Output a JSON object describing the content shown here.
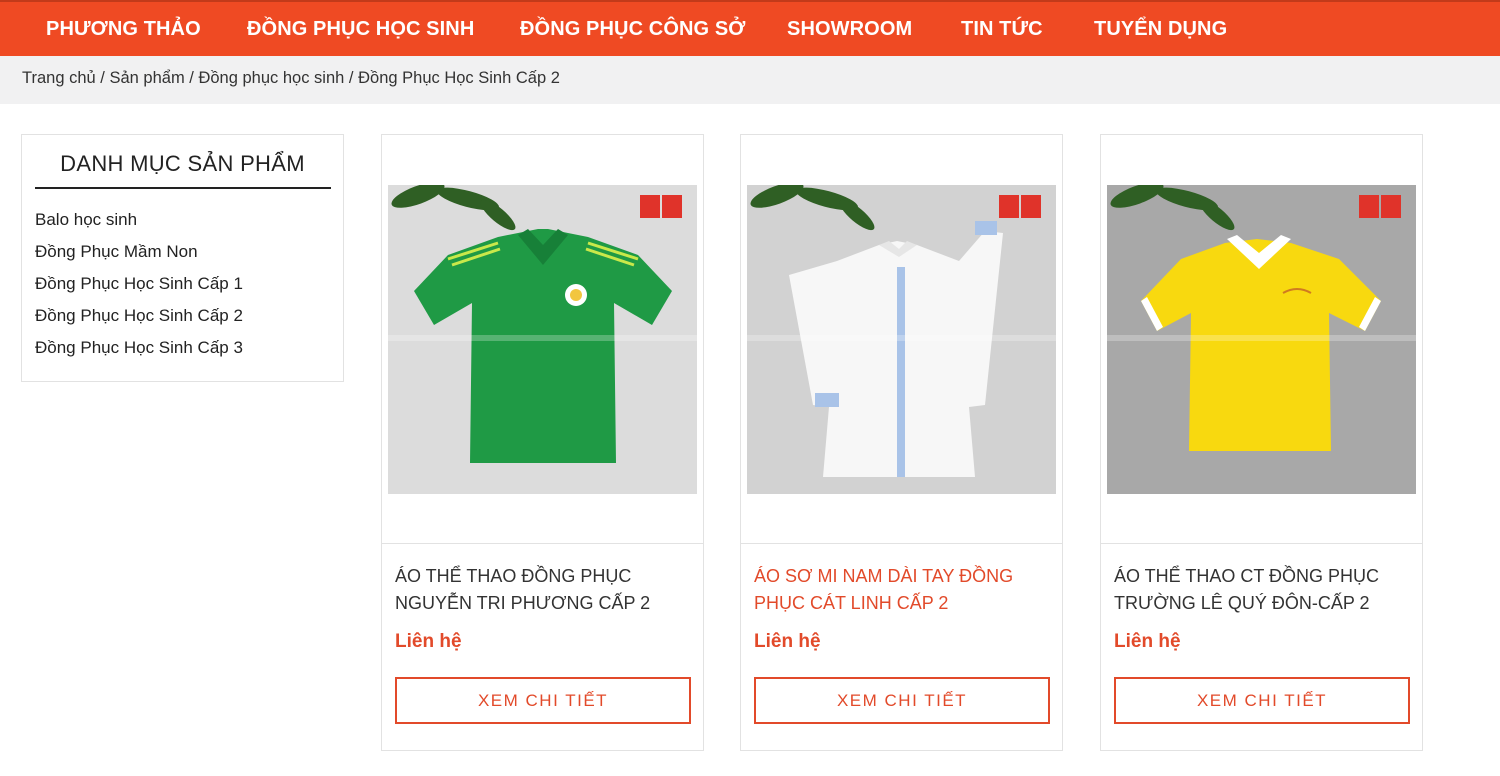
{
  "nav": {
    "items": [
      "PHƯƠNG THẢO",
      "ĐỒNG PHỤC HỌC SINH",
      "ĐỒNG PHỤC CÔNG SỞ",
      "SHOWROOM",
      "TIN TỨC",
      "TUYỂN DỤNG"
    ]
  },
  "breadcrumb": {
    "items": [
      "Trang chủ",
      "Sản phẩm",
      "Đồng phục học sinh",
      "Đồng Phục Học Sinh Cấp 2"
    ],
    "separator": "/"
  },
  "sidebar": {
    "title": "DANH MỤC SẢN PHẨM",
    "categories": [
      "Balo học sinh",
      "Đồng Phục Mầm Non",
      "Đồng Phục Học Sinh Cấp 1",
      "Đồng Phục Học Sinh Cấp 2",
      "Đồng Phục Học Sinh Cấp 3"
    ]
  },
  "products": [
    {
      "title_line1": "ÁO THỂ THAO ĐỒNG PHỤC",
      "title_line2": "NGUYỄN TRI PHƯƠNG CẤP 2",
      "price": "Liên hệ",
      "button": "XEM CHI TIẾT",
      "shirt_color": "#1f9a45"
    },
    {
      "title_line1": "ÁO SƠ MI NAM DÀI TAY ĐỒNG",
      "title_line2": "PHỤC CÁT LINH CẤP 2",
      "price": "Liên hệ",
      "button": "XEM CHI TIẾT",
      "shirt_color": "#f7f7f7"
    },
    {
      "title_line1": "ÁO THỂ THAO CT ĐỒNG PHỤC",
      "title_line2": "TRƯỜNG LÊ QUÝ ĐÔN-CẤP 2",
      "price": "Liên hệ",
      "button": "XEM CHI TIẾT",
      "shirt_color": "#f8d90f"
    }
  ],
  "colors": {
    "brand": "#ef4a23",
    "accent": "#e24a2a",
    "breadcrumb_bg": "#f1f1f2"
  }
}
